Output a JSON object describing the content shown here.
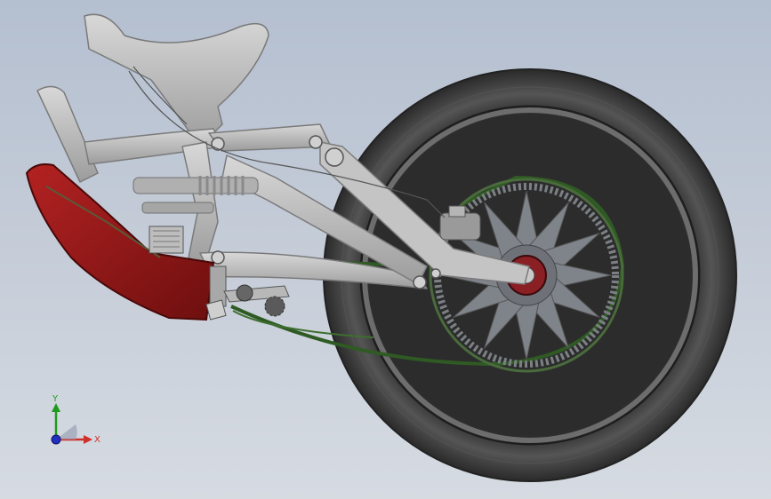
{
  "viewport": {
    "colors": {
      "background_top": "#b4bfd0",
      "background_bottom": "#d6dbe2",
      "frame": "#bcbcbc",
      "frame_shadow": "#8e8e8e",
      "tire": "#3e3e3e",
      "rim": "#6a6a6a",
      "sprocket": "#8a8d93",
      "chain": "#2f5a24",
      "hub": "#8a1f24",
      "guard": "#8e1717"
    }
  },
  "triad": {
    "y_label": "Y",
    "x_label": "X",
    "colors": {
      "y": "#1f9a1f",
      "x": "#d0302a",
      "z": "#2030c0"
    }
  }
}
